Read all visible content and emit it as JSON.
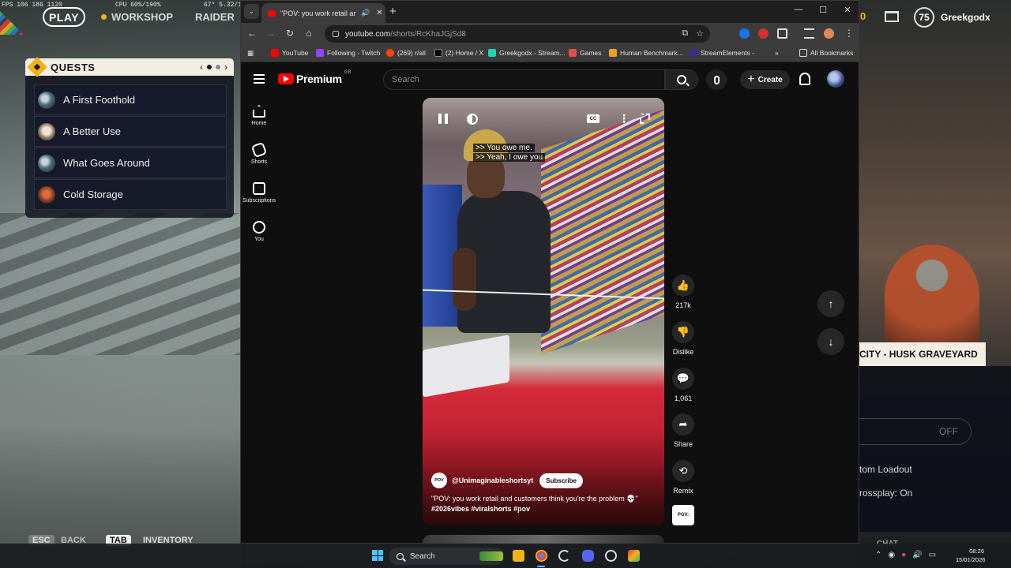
{
  "game": {
    "fps_text": "FPS 106 186 1120",
    "cpu_text": "CPU 60%/190%",
    "gpu_text": "67° 5.32/1",
    "play_label": "PLAY",
    "workshop_label": "WORKSHOP",
    "raider_label": "RAIDER",
    "quests": {
      "title": "QUESTS",
      "prev": "‹",
      "next": "›",
      "items": [
        {
          "label": "A First Foothold"
        },
        {
          "label": "A Better Use"
        },
        {
          "label": "What Goes Around"
        },
        {
          "label": "Cold Storage"
        }
      ]
    },
    "bottom_keys": {
      "esc": "ESC",
      "back": "BACK",
      "tab": "TAB",
      "inventory": "INVENTORY"
    },
    "profile": {
      "level": "75",
      "name": "Greekgodx",
      "edge_number": "0"
    },
    "right_panel": {
      "city_title": "CITY - HUSK GRAVEYARD",
      "toggle_value": "OFF",
      "custom_loadout": "tom Loadout",
      "crossplay": "rossplay: On",
      "chat": "CHAT"
    }
  },
  "browser": {
    "tab": {
      "title": "\"POV: you work retail and c",
      "close": "✕"
    },
    "new_tab": "+",
    "window_controls": {
      "minimize": "—",
      "maximize": "☐",
      "close": "✕"
    },
    "url_host": "youtube.com",
    "url_path": "/shorts/RcKhaJGjSd8",
    "bookmarks": [
      {
        "label": "YouTube",
        "color": "#ff0000"
      },
      {
        "label": "Following - Twitch",
        "color": "#9146ff"
      },
      {
        "label": "(269) r/all",
        "color": "#ff4500"
      },
      {
        "label": "(2) Home / X",
        "color": "#000000"
      },
      {
        "label": "Greekgodx - Stream...",
        "color": "#1ed3b4"
      },
      {
        "label": "Games",
        "color": "#e34c4c"
      },
      {
        "label": "Human Benchmark...",
        "color": "#f0a020"
      },
      {
        "label": "StreamElements -",
        "color": "#3b2a9a"
      }
    ],
    "bookmarks_more": "»",
    "all_bookmarks": "All Bookmarks"
  },
  "youtube": {
    "logo_text": "Premium",
    "logo_region": "GB",
    "search_placeholder": "Search",
    "create_label": "Create",
    "sidebar": [
      {
        "label": "Home",
        "icon": "home-icon"
      },
      {
        "label": "Shorts",
        "icon": "shorts-icon"
      },
      {
        "label": "Subscriptions",
        "icon": "subscriptions-icon"
      },
      {
        "label": "You",
        "icon": "you-icon"
      }
    ],
    "video": {
      "captions": [
        ">> You owe me.",
        ">> Yeah, I owe you"
      ],
      "cc_label": "CC",
      "channel_avatar_text": "POV",
      "channel_name": "@Unimaginableshortsyt",
      "subscribe_label": "Subscribe",
      "description": "\"POV: you work retail and customers think you're the problem 💀\"",
      "hashtags": "#2026vibes #viralshorts #pov"
    },
    "actions": {
      "likes": "217k",
      "dislike": "Dislike",
      "comments": "1,061",
      "share": "Share",
      "remix": "Remix",
      "sound_thumb": "POV:"
    }
  },
  "taskbar": {
    "search_label": "Search",
    "time": "08:26",
    "date": "15/01/2026"
  }
}
